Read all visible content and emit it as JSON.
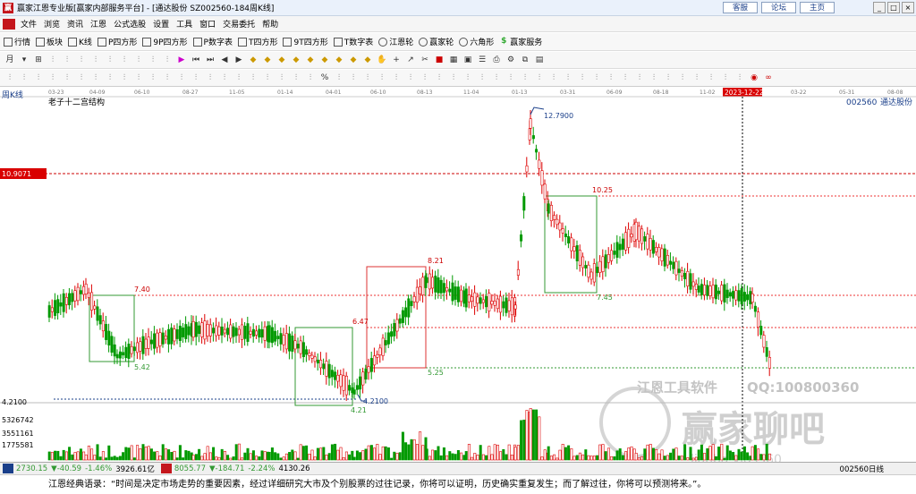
{
  "window": {
    "icon_text": "赢",
    "title": "赢家江恩专业版[赢家内部服务平台] - [通达股份  SZ002560-184周K线]",
    "links": [
      "客服",
      "论坛",
      "主页"
    ],
    "controls": [
      "_",
      "□",
      "×"
    ]
  },
  "menu": [
    "文件",
    "浏览",
    "资讯",
    "江恩",
    "公式选股",
    "设置",
    "工具",
    "窗口",
    "交易委托",
    "帮助"
  ],
  "toolbar1": [
    {
      "label": "行情",
      "icon": "grid-icon"
    },
    {
      "label": "板块",
      "icon": "blocks-icon"
    },
    {
      "label": "K线",
      "icon": "kline-icon"
    },
    {
      "label": "P四方形",
      "icon": "p4-icon"
    },
    {
      "label": "9P四方形",
      "icon": "9p4-icon"
    },
    {
      "label": "P数字表",
      "icon": "pnum-icon"
    },
    {
      "label": "T四方形",
      "icon": "t4-icon"
    },
    {
      "label": "9T四方形",
      "icon": "9t4-icon"
    },
    {
      "label": "T数字表",
      "icon": "tnum-icon"
    },
    {
      "label": "江恩轮",
      "icon": "gann-wheel-icon"
    },
    {
      "label": "赢家轮",
      "icon": "winner-wheel-icon"
    },
    {
      "label": "六角形",
      "icon": "hexagon-icon"
    },
    {
      "label": "赢家服务",
      "icon": "dollar-icon"
    }
  ],
  "toolbar2_first": "月",
  "toolbar3_pct": "%",
  "dates": [
    "03-23",
    "04-09",
    "06-10",
    "08-27",
    "11-05",
    "01-14",
    "04-01",
    "06-10",
    "08-13",
    "11-04",
    "01-13",
    "03-31",
    "06-09",
    "08-18",
    "11-02",
    "2023-12-22",
    "03-22",
    "05-31",
    "08-08"
  ],
  "chart": {
    "period_label": "周K线",
    "pattern_name": "老子十二宫结构",
    "stock_code": "002560",
    "stock_name": "通达股份",
    "price_marker": "10.9071",
    "cursor_date": "2023-12-22",
    "annotations": [
      "12.7900",
      "10.25",
      "8.21",
      "7.40",
      "7.45",
      "6.47",
      "5.42",
      "5.25",
      "4.2100",
      "4.21"
    ],
    "left_low_label": "4.2100",
    "volume_ticks": [
      "5326742",
      "3551161",
      "1775581"
    ],
    "watermark": {
      "line1": "江恩工具软件",
      "qq": "QQ:100800360",
      "brand": "赢家聊吧",
      "url": "liaoba.yjgs360"
    }
  },
  "status": {
    "sh_index": "2730.15",
    "sh_change": "▼-40.59",
    "sh_pct": "-1.46%",
    "sh_amount": "3926.61亿",
    "sz_index": "8055.77",
    "sz_change": "▼-184.71",
    "sz_pct": "-2.24%",
    "sz_amount": "4130.26",
    "right": "002560日线"
  },
  "quote": "江恩经典语录：“时间是决定市场走势的重要因素，经过详细研究大市及个别股票的过往记录，你将可以证明，历史确实重复发生；而了解过往，你将可以预测将来。”。",
  "colors": {
    "up": "#e00000",
    "down": "#0a8a0a",
    "panel_bg": "#ffffff",
    "accent": "#c4161c"
  }
}
